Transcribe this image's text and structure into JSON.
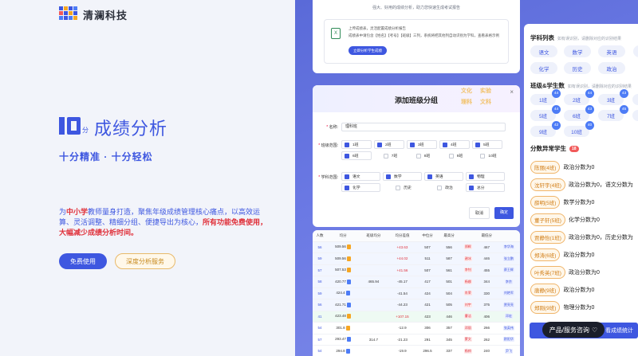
{
  "brand": {
    "name": "清澜科技",
    "logo_colors": [
      "#3e57e0",
      "#f6a623",
      "#4d7cf6",
      "#f15a5a"
    ]
  },
  "hero": {
    "icon_small": "分",
    "title": "成绩分析",
    "subtitle": "十分精准 · 十分轻松",
    "desc_parts": [
      "为",
      "中小学",
      "教师量身打造，聚焦年级成绩管理核心痛点，以高效运算、灵活调整、精细分组、便捷导出为核心，",
      "所有功能免费使用，大幅减少成绩分析时间。"
    ],
    "btn_primary": "免费使用",
    "btn_secondary": "深度分析服务",
    "accent": "#3e57e0"
  },
  "upload_card": {
    "caption": "强大、好用的成绩分析，助力您快速生成考试报告",
    "line1": "上传成绩表，灵活配置成绩分析报告",
    "line2": "成绩表中请包含【姓名】【考号】【班级】三列，系统将把其他列自动识别为学科，查看表格示例",
    "button": "立即分析学生成绩"
  },
  "modal": {
    "title": "添加班级分组",
    "close": "×",
    "chips": [
      "文化",
      "实验",
      "理科",
      "文科"
    ],
    "name_label": "名称:",
    "name_value": "理科班",
    "classes_label": "班级范围:",
    "classes": [
      {
        "label": "1班",
        "on": true
      },
      {
        "label": "2班",
        "on": true
      },
      {
        "label": "3班",
        "on": true
      },
      {
        "label": "4班",
        "on": true
      },
      {
        "label": "5班",
        "on": true
      },
      {
        "label": "6班",
        "on": true
      },
      {
        "label": "7班",
        "on": false
      },
      {
        "label": "8班",
        "on": false
      },
      {
        "label": "9班",
        "on": false
      },
      {
        "label": "10班",
        "on": false
      }
    ],
    "subjects_label": "学科范围:",
    "subjects": [
      {
        "label": "语文",
        "on": true
      },
      {
        "label": "数学",
        "on": true
      },
      {
        "label": "英语",
        "on": true
      },
      {
        "label": "物理",
        "on": true
      },
      {
        "label": "化学",
        "on": true
      },
      {
        "label": "历史",
        "on": false
      },
      {
        "label": "政治",
        "on": false
      },
      {
        "label": "总分",
        "on": true
      }
    ],
    "cancel": "取消",
    "ok": "确定"
  },
  "table": {
    "headers": [
      "人数",
      "均分",
      "班级均分",
      "均分差值",
      "中位分",
      "最高分",
      "",
      "最低分",
      ""
    ],
    "rows": [
      {
        "c": "56",
        "avg": "509.56",
        "tag": "o",
        "cavg": "",
        "diff": "+43.63",
        "med": "507",
        "hi": "556",
        "hin": "郑辉",
        "lo": "467",
        "lon": "李华海",
        "style": "bl"
      },
      {
        "c": "59",
        "avg": "509.56",
        "tag": "o",
        "cavg": "",
        "diff": "+44.02",
        "med": "511",
        "hi": "587",
        "hin": "谢冰",
        "lo": "446",
        "lon": "张立鹏",
        "style": "bl"
      },
      {
        "c": "57",
        "avg": "507.53",
        "tag": "o",
        "cavg": "",
        "diff": "+41.56",
        "med": "507",
        "hi": "561",
        "hin": "李钊",
        "lo": "455",
        "lon": "蔡王辉",
        "style": "bl"
      },
      {
        "c": "58",
        "avg": "420.77",
        "tag": "bb",
        "cavg": "465.94",
        "diff": "-45.17",
        "med": "417",
        "hi": "501",
        "hin": "杨娜",
        "lo": "344",
        "lon": "李京",
        "style": "bl"
      },
      {
        "c": "59",
        "avg": "424.4",
        "tag": "bb",
        "cavg": "",
        "diff": "-41.54",
        "med": "424",
        "hi": "504",
        "hin": "肖荣",
        "lo": "330",
        "lon": "刘艳军",
        "style": "bl"
      },
      {
        "c": "56",
        "avg": "421.71",
        "tag": "bb",
        "cavg": "",
        "diff": "-44.23",
        "med": "421",
        "hi": "505",
        "hin": "刘宇",
        "lo": "375",
        "lon": "贾亮亮",
        "style": "bl"
      },
      {
        "c": "41",
        "avg": "423.48",
        "tag": "o",
        "cavg": "",
        "diff": "+107.15",
        "med": "423",
        "hi": "446",
        "hin": "曹洁",
        "lo": "406",
        "lon": "邓宏",
        "style": "g"
      },
      {
        "c": "54",
        "avg": "301.8",
        "tag": "o",
        "cavg": "",
        "diff": "-12.9",
        "med": "306",
        "hi": "357",
        "hin": "邓丽",
        "lo": "266",
        "lon": "张英伟",
        "style": ""
      },
      {
        "c": "57",
        "avg": "293.47",
        "tag": "bb",
        "cavg": "314.7",
        "diff": "-21.23",
        "med": "291",
        "hi": "345",
        "hin": "蒙文",
        "lo": "262",
        "lon": "欧阳华",
        "style": ""
      },
      {
        "c": "54",
        "avg": "294.8",
        "tag": "bb",
        "cavg": "",
        "diff": "-19.9",
        "med": "296.5",
        "hi": "337",
        "hin": "杨帅",
        "lo": "240",
        "lon": "尹飞",
        "style": ""
      },
      {
        "c": "41",
        "avg": "293.88",
        "tag": "bb",
        "cavg": "",
        "diff": "-20.82",
        "med": "291",
        "hi": "338",
        "hin": "蔡少",
        "lo": "250",
        "lon": "刘红",
        "style": ""
      }
    ]
  },
  "side": {
    "subjects_title": "学科列表",
    "subjects_hint": "如有误识别，请删除对应的识别结果",
    "subjects": [
      "语文",
      "数学",
      "英语",
      "物",
      "化学",
      "历史",
      "政治"
    ],
    "classes_title": "班级&学生数",
    "classes_hint": "如有误识别，请删除对应的识别结果",
    "classes": [
      {
        "l": "1班",
        "n": "44"
      },
      {
        "l": "2班",
        "n": "44"
      },
      {
        "l": "3班",
        "n": "43"
      },
      {
        "l": "4",
        "n": ""
      },
      {
        "l": "5班",
        "n": "44"
      },
      {
        "l": "6班",
        "n": "43"
      },
      {
        "l": "7班",
        "n": "45"
      },
      {
        "l": "8",
        "n": ""
      },
      {
        "l": "9班",
        "n": "42"
      },
      {
        "l": "10班",
        "n": "40"
      }
    ],
    "abn_title": "分数异常学生",
    "abn_count": "18",
    "abnormal": [
      {
        "n": "陈丽(4班)",
        "t": "政治分数为0"
      },
      {
        "n": "沈轩宇(4班)",
        "t": "政治分数为0，语文分数为"
      },
      {
        "n": "薛明(5班)",
        "t": "数学分数为0"
      },
      {
        "n": "董子轩(5班)",
        "t": "化学分数为0"
      },
      {
        "n": "贾静怡(1班)",
        "t": "政治分数为0，历史分数为"
      },
      {
        "n": "郑涛(6班)",
        "t": "政治分数为0"
      },
      {
        "n": "叶秀英(7班)",
        "t": "政治分数为0"
      },
      {
        "n": "唐静(9班)",
        "t": "政治分数为0"
      },
      {
        "n": "郑刚(9班)",
        "t": "物理分数为0"
      }
    ],
    "fab": "看成绩统计",
    "consult": "产品/服务咨询"
  }
}
